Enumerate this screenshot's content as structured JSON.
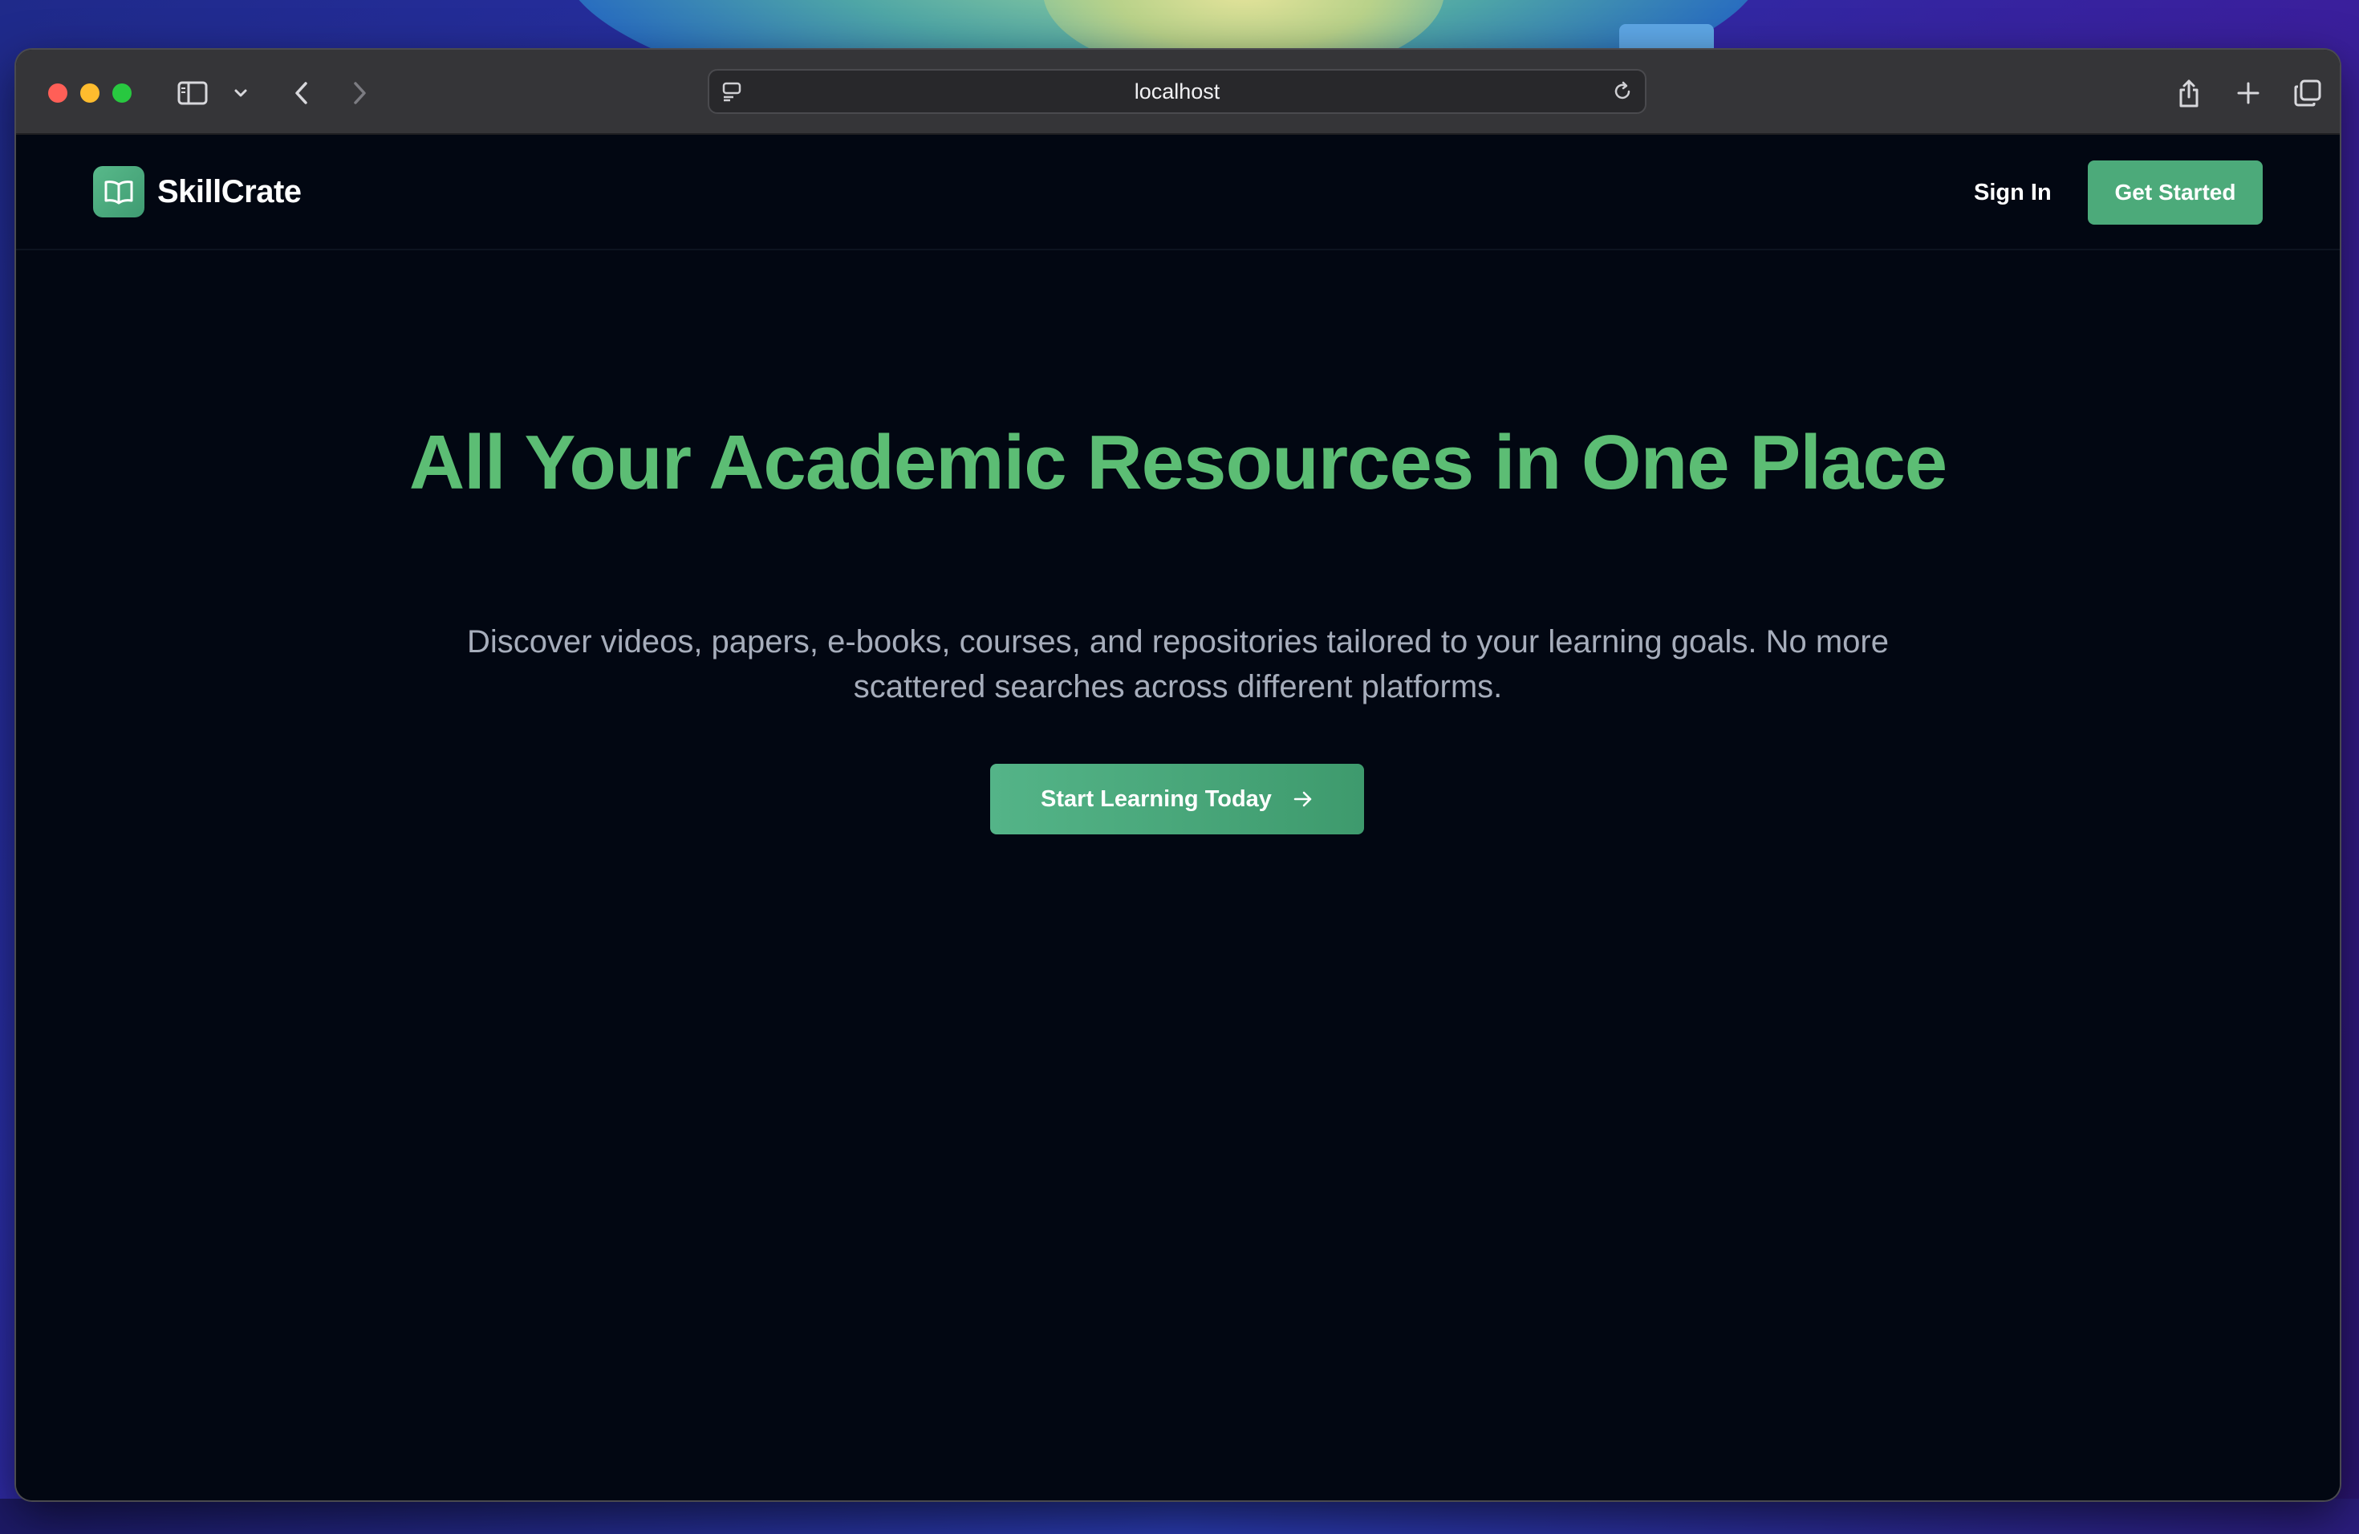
{
  "browser": {
    "url": "localhost"
  },
  "nav": {
    "brand_name": "SkillCrate",
    "sign_in_label": "Sign In",
    "get_started_label": "Get Started"
  },
  "hero": {
    "title": "All Your Academic Resources in One Place",
    "subtitle": "Discover videos, papers, e-books, courses, and repositories tailored to your learning goals. No more scattered searches across different platforms.",
    "cta_label": "Start Learning Today"
  },
  "icons": {
    "brand_logo": "open-book-icon",
    "cta": "arrow-right-icon",
    "toolbar": [
      "sidebar-icon",
      "chevron-down-icon",
      "back-icon",
      "forward-icon",
      "page-menu-icon",
      "reload-icon",
      "share-icon",
      "new-tab-icon",
      "tabs-overview-icon"
    ]
  },
  "colors": {
    "accent": "#4caa7a",
    "title": "#5cbd74",
    "background": "#020712",
    "subtitle": "#a6adbb"
  }
}
